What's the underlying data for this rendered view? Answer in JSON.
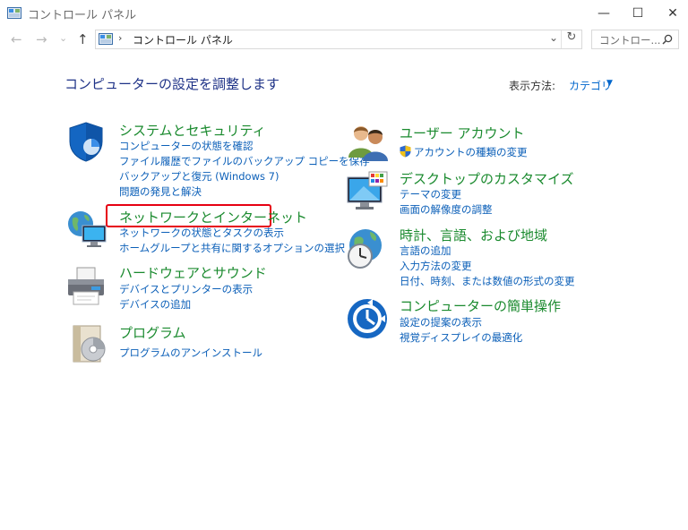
{
  "window": {
    "title": "コントロール パネル",
    "minimize_glyph": "—",
    "maximize_glyph": "☐",
    "close_glyph": "✕"
  },
  "nav": {
    "back_glyph": "←",
    "forward_glyph": "→",
    "recent_glyph": "⌄",
    "up_glyph": "↑",
    "address_separator": "›",
    "address_text": "コントロール パネル",
    "address_dropdown_glyph": "⌄",
    "refresh_glyph": "↻",
    "search_placeholder": "コントロー..."
  },
  "header": {
    "title": "コンピューターの設定を調整します",
    "view_by_label": "表示方法:",
    "view_by_value": "カテゴリ",
    "view_by_caret": "▼"
  },
  "colors": {
    "category_title": "#1a8a2e",
    "link": "#0b5fb8",
    "heading": "#1e3287",
    "highlight": "#e60012"
  },
  "categories": {
    "system_security": {
      "title": "システムとセキュリティ",
      "icon": "shield-icon",
      "links": [
        "コンピューターの状態を確認",
        "ファイル履歴でファイルのバックアップ コピーを保存",
        "バックアップと復元 (Windows 7)",
        "問題の発見と解決"
      ]
    },
    "network": {
      "title": "ネットワークとインターネット",
      "icon": "network-globe-icon",
      "links": [
        "ネットワークの状態とタスクの表示",
        "ホームグループと共有に関するオプションの選択"
      ]
    },
    "hardware": {
      "title": "ハードウェアとサウンド",
      "icon": "printer-icon",
      "links": [
        "デバイスとプリンターの表示",
        "デバイスの追加"
      ]
    },
    "programs": {
      "title": "プログラム",
      "icon": "programs-disc-icon",
      "links": [
        "プログラムのアンインストール"
      ]
    },
    "user_accounts": {
      "title": "ユーザー アカウント",
      "icon": "users-icon",
      "links": [
        "アカウントの種類の変更"
      ]
    },
    "appearance": {
      "title": "デスクトップのカスタマイズ",
      "icon": "monitor-palette-icon",
      "links": [
        "テーマの変更",
        "画面の解像度の調整"
      ]
    },
    "clock_region": {
      "title": "時計、言語、および地域",
      "icon": "globe-clock-icon",
      "links": [
        "言語の追加",
        "入力方法の変更",
        "日付、時刻、または数値の形式の変更"
      ]
    },
    "ease_of_access": {
      "title": "コンピューターの簡単操作",
      "icon": "ease-of-access-icon",
      "links": [
        "設定の提案の表示",
        "視覚ディスプレイの最適化"
      ]
    }
  }
}
